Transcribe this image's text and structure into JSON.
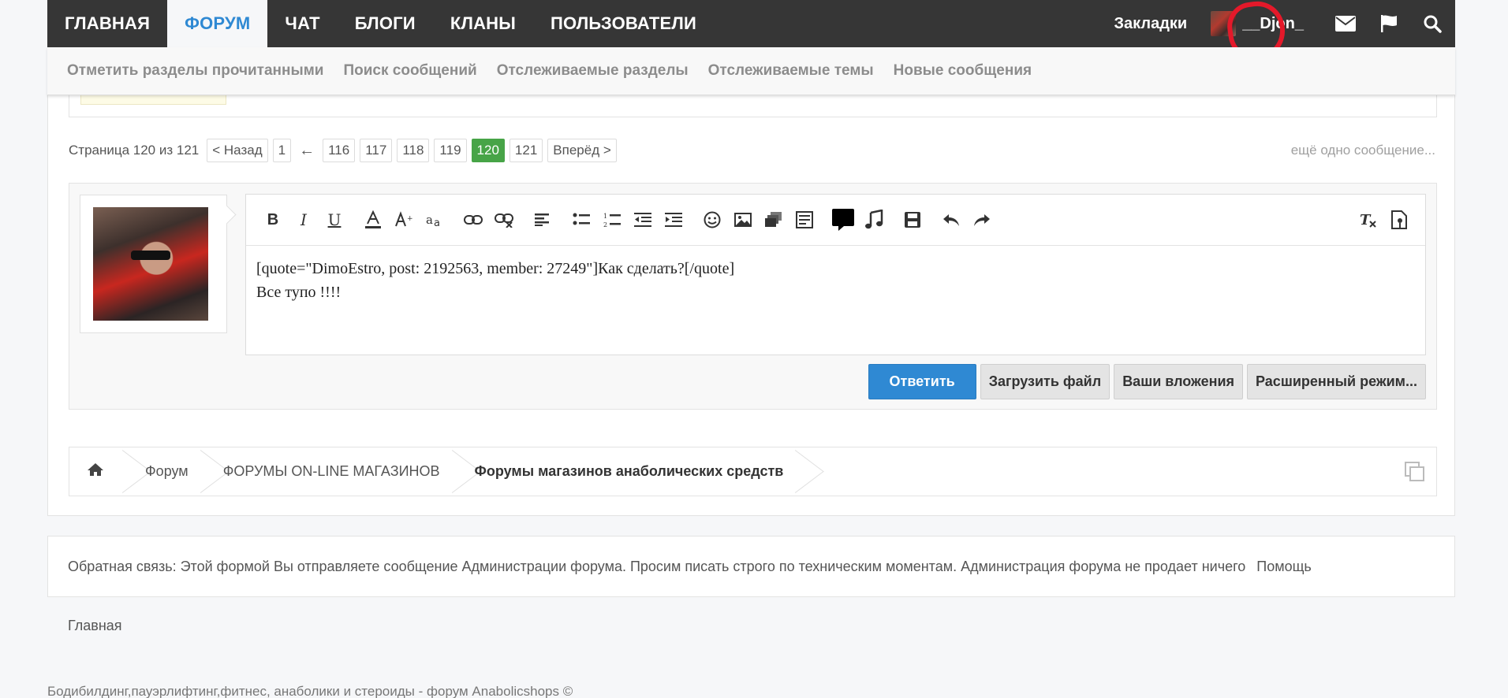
{
  "topnav": {
    "tabs": [
      {
        "label": "ГЛАВНАЯ"
      },
      {
        "label": "ФОРУМ"
      },
      {
        "label": "ЧАТ"
      },
      {
        "label": "БЛОГИ"
      },
      {
        "label": "КЛАНЫ"
      },
      {
        "label": "ПОЛЬЗОВАТЕЛИ"
      }
    ],
    "bookmarks": "Закладки",
    "username": "__Djon_",
    "icons": [
      "envelope-icon",
      "flag-icon",
      "search-icon"
    ],
    "active_color": "#2f89d3"
  },
  "subnav": {
    "items": [
      "Отметить разделы прочитанными",
      "Поиск сообщений",
      "Отслеживаемые разделы",
      "Отслеживаемые темы",
      "Новые сообщения"
    ]
  },
  "pagination": {
    "label": "Страница 120 из 121",
    "prev": "< Назад",
    "first": "1",
    "ellipsis_arrow": "←",
    "pages": [
      "116",
      "117",
      "118",
      "119",
      "120",
      "121"
    ],
    "current": "120",
    "next": "Вперёд >",
    "current_color": "#47a447"
  },
  "more_message": "ещё одно сообщение...",
  "editor": {
    "text": "[quote=\"DimoEstro, post: 2192563, member: 27249\"]Как сделать?[/quote]\nВсе тупо !!!!"
  },
  "buttons": {
    "reply": "Ответить",
    "upload": "Загрузить файл",
    "attachments": "Ваши вложения",
    "advanced": "Расширенный режим..."
  },
  "breadcrumb": {
    "items": [
      "Форум",
      "ФОРУМЫ ON-LINE МАГАЗИНОВ",
      "Форумы магазинов анаболических средств"
    ]
  },
  "footer": {
    "feedback": "Обратная связь: Этой формой Вы отправляете сообщение Администрации форума. Просим писать строго по техническим моментам. Администрация форума не продает ничего",
    "help": "Помощь",
    "home": "Главная",
    "copyright": "Бодибилдинг,пауэрлифтинг,фитнес, анаболики и стероиды - форум Anabolicshops ©"
  }
}
